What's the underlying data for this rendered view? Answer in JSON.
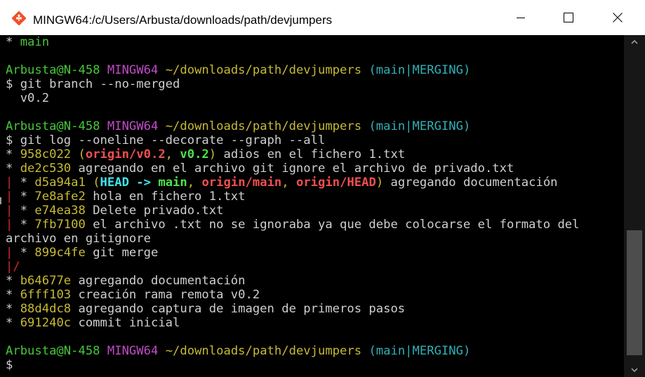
{
  "window": {
    "title": "MINGW64:/c/Users/Arbusta/downloads/path/devjumpers",
    "icon": "git-bash-icon",
    "controls": {
      "minimize": "minimize-icon",
      "maximize": "maximize-icon",
      "close": "close-icon"
    }
  },
  "colors": {
    "background": "#000000",
    "text": "#cfcfcf",
    "user_host": "#47c73a",
    "mingw": "#c14bc7",
    "path": "#c7ba34",
    "branch": "#31b0b6",
    "graph": "#d02a2a"
  },
  "terminal": {
    "lines": [
      [
        {
          "t": "* ",
          "c": "white"
        },
        {
          "t": "main",
          "c": "green"
        }
      ],
      [
        {
          "t": "",
          "c": "white"
        }
      ],
      [
        {
          "t": "Arbusta@N-458",
          "c": "green"
        },
        {
          "t": " ",
          "c": "white"
        },
        {
          "t": "MINGW64",
          "c": "magenta"
        },
        {
          "t": " ",
          "c": "white"
        },
        {
          "t": "~/downloads/path/devjumpers",
          "c": "yellow"
        },
        {
          "t": " ",
          "c": "white"
        },
        {
          "t": "(main|MERGING)",
          "c": "cyan"
        }
      ],
      [
        {
          "t": "$ git branch --no-merged",
          "c": "white"
        }
      ],
      [
        {
          "t": "  v0.2",
          "c": "white"
        }
      ],
      [
        {
          "t": "",
          "c": "white"
        }
      ],
      [
        {
          "t": "Arbusta@N-458",
          "c": "green"
        },
        {
          "t": " ",
          "c": "white"
        },
        {
          "t": "MINGW64",
          "c": "magenta"
        },
        {
          "t": " ",
          "c": "white"
        },
        {
          "t": "~/downloads/path/devjumpers",
          "c": "yellow"
        },
        {
          "t": " ",
          "c": "white"
        },
        {
          "t": "(main|MERGING)",
          "c": "cyan"
        }
      ],
      [
        {
          "t": "$ git log --oneline --decorate --graph --all",
          "c": "white"
        }
      ],
      [
        {
          "t": "* ",
          "c": "white"
        },
        {
          "t": "958c022",
          "c": "yellow"
        },
        {
          "t": " (",
          "c": "yellow"
        },
        {
          "t": "origin/v0.2",
          "c": "b-red"
        },
        {
          "t": ", ",
          "c": "yellow"
        },
        {
          "t": "v0.2",
          "c": "b-green"
        },
        {
          "t": ")",
          "c": "yellow"
        },
        {
          "t": " adios en el fichero 1.txt",
          "c": "white"
        }
      ],
      [
        {
          "t": "* ",
          "c": "white"
        },
        {
          "t": "de2c530",
          "c": "yellow"
        },
        {
          "t": " agregando en el archivo git ignore el archivo de privado.txt",
          "c": "white"
        }
      ],
      [
        {
          "t": "| ",
          "c": "red"
        },
        {
          "t": "* ",
          "c": "white"
        },
        {
          "t": "d5a94a1",
          "c": "yellow"
        },
        {
          "t": " (",
          "c": "yellow"
        },
        {
          "t": "HEAD -> ",
          "c": "b-cyan"
        },
        {
          "t": "main",
          "c": "b-green"
        },
        {
          "t": ", ",
          "c": "yellow"
        },
        {
          "t": "origin/main",
          "c": "b-red"
        },
        {
          "t": ", ",
          "c": "yellow"
        },
        {
          "t": "origin/HEAD",
          "c": "b-red"
        },
        {
          "t": ")",
          "c": "yellow"
        },
        {
          "t": " agregando documentación",
          "c": "white"
        }
      ],
      [
        {
          "t": "| ",
          "c": "red"
        },
        {
          "t": "* ",
          "c": "white"
        },
        {
          "t": "7e8afe2",
          "c": "yellow"
        },
        {
          "t": " hola en fichero 1.txt",
          "c": "white"
        }
      ],
      [
        {
          "t": "| ",
          "c": "red"
        },
        {
          "t": "* ",
          "c": "white"
        },
        {
          "t": "e74ea38",
          "c": "yellow"
        },
        {
          "t": " Delete privado.txt",
          "c": "white"
        }
      ],
      [
        {
          "t": "| ",
          "c": "red"
        },
        {
          "t": "* ",
          "c": "white"
        },
        {
          "t": "7fb7100",
          "c": "yellow"
        },
        {
          "t": " el archivo .txt no se ignoraba ya que debe colocarse el formato del",
          "c": "white"
        }
      ],
      [
        {
          "t": "archivo en gitignore",
          "c": "white"
        }
      ],
      [
        {
          "t": "| ",
          "c": "red"
        },
        {
          "t": "* ",
          "c": "white"
        },
        {
          "t": "899c4fe",
          "c": "yellow"
        },
        {
          "t": " git merge",
          "c": "white"
        }
      ],
      [
        {
          "t": "|/",
          "c": "red"
        }
      ],
      [
        {
          "t": "* ",
          "c": "white"
        },
        {
          "t": "b64677e",
          "c": "yellow"
        },
        {
          "t": " agregando documentación",
          "c": "white"
        }
      ],
      [
        {
          "t": "* ",
          "c": "white"
        },
        {
          "t": "6fff103",
          "c": "yellow"
        },
        {
          "t": " creación rama remota v0.2",
          "c": "white"
        }
      ],
      [
        {
          "t": "* ",
          "c": "white"
        },
        {
          "t": "88d4dc8",
          "c": "yellow"
        },
        {
          "t": " agregando captura de imagen de primeros pasos",
          "c": "white"
        }
      ],
      [
        {
          "t": "* ",
          "c": "white"
        },
        {
          "t": "691240c",
          "c": "yellow"
        },
        {
          "t": " commit inicial",
          "c": "white"
        }
      ],
      [
        {
          "t": "",
          "c": "white"
        }
      ],
      [
        {
          "t": "Arbusta@N-458",
          "c": "green"
        },
        {
          "t": " ",
          "c": "white"
        },
        {
          "t": "MINGW64",
          "c": "magenta"
        },
        {
          "t": " ",
          "c": "white"
        },
        {
          "t": "~/downloads/path/devjumpers",
          "c": "yellow"
        },
        {
          "t": " ",
          "c": "white"
        },
        {
          "t": "(main|MERGING)",
          "c": "cyan"
        }
      ],
      [
        {
          "t": "$",
          "c": "white"
        }
      ]
    ]
  },
  "scrollbar": {
    "up": "scroll-up-arrow-icon",
    "down": "scroll-down-arrow-icon"
  }
}
